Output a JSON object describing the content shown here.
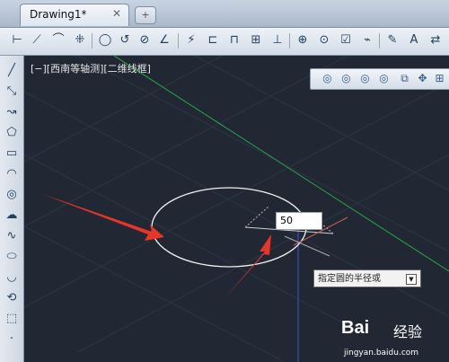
{
  "tab": {
    "title": "Drawing1*",
    "close_glyph": "✕",
    "new_glyph": "+"
  },
  "viewport_label": "[−][西南等轴测][二维线框]",
  "dynamic_input": {
    "value": "50"
  },
  "prompt": {
    "text": "指定圆的半径或",
    "icon": "down-arrow-icon"
  },
  "watermark": {
    "brand": "Bai",
    "suffix": "经验",
    "url": "jingyan.baidu.com"
  },
  "colors": {
    "canvas": "#212834",
    "annotation_arrow": "#e8352a",
    "axis_green": "#2fa34a"
  }
}
